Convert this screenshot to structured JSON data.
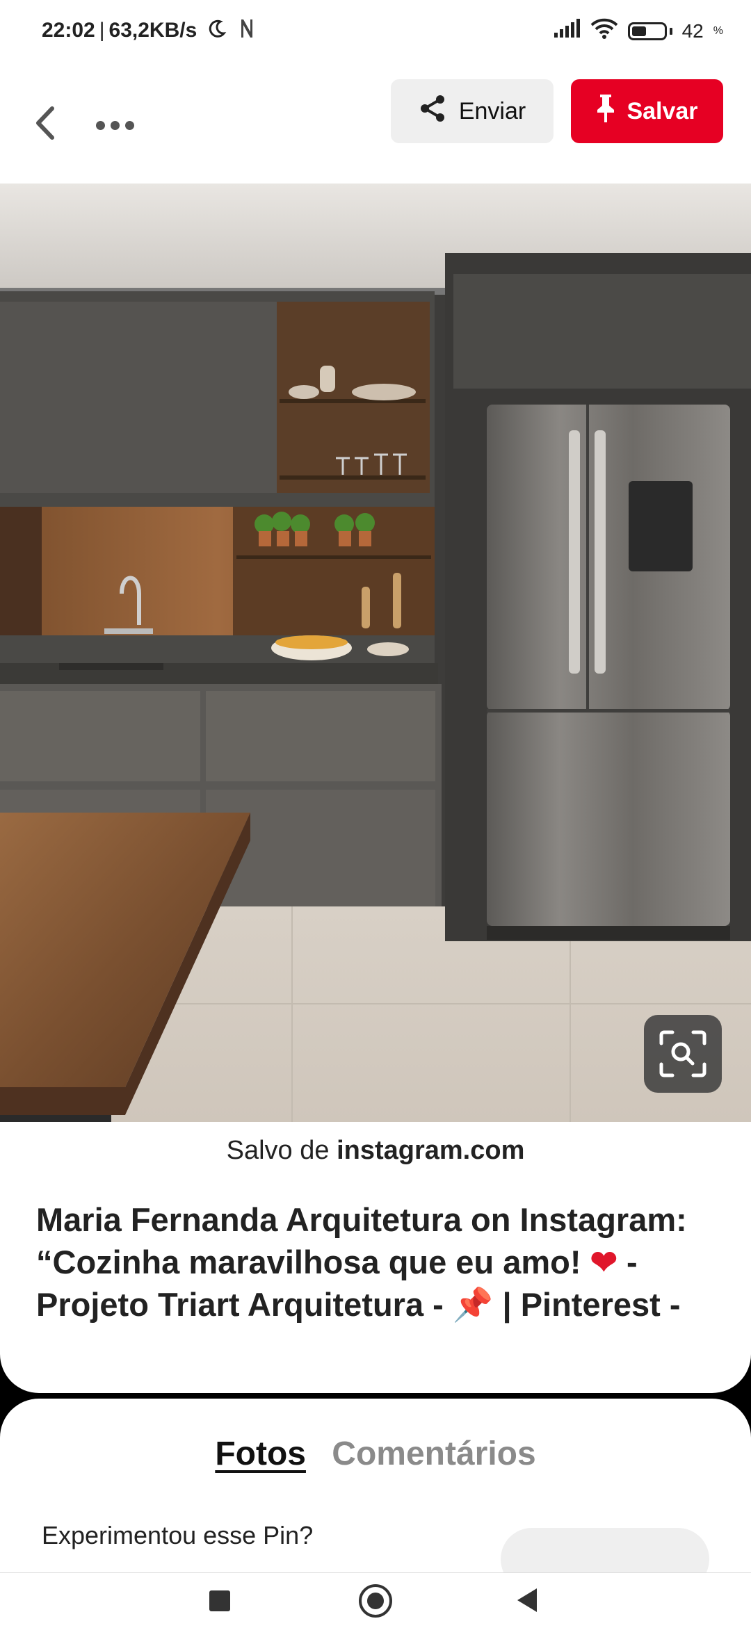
{
  "status_bar": {
    "time": "22:02",
    "separator": "|",
    "network_speed": "63,2KB/s",
    "battery": "42"
  },
  "header": {
    "send_label": "Enviar",
    "save_label": "Salvar",
    "accent_color": "#e60023"
  },
  "pin": {
    "source_prefix": "Salvo de",
    "source_domain": "instagram.com",
    "title_line1": "Maria Fernanda Arquitetura on Instagram:",
    "title_line2_a": "“Cozinha maravilhosa que eu amo!",
    "title_line2_b": "-",
    "title_line3_a": "Projeto Triart Arquitetura -",
    "title_line3_b": "| Pinterest -",
    "heart": "❤",
    "pin_emoji": "📌"
  },
  "tabs": {
    "photos": "Fotos",
    "comments": "Comentários"
  },
  "tried_prompt": "Experimentou esse Pin?",
  "icons": {
    "moon": "moon-icon",
    "notification": "n-notification-icon",
    "signal": "signal-icon",
    "wifi": "wifi-icon",
    "battery": "battery-icon",
    "back": "chevron-left-icon",
    "more": "more-horizontal-icon",
    "share": "share-icon",
    "pin": "pushpin-icon",
    "lens": "visual-search-icon"
  }
}
